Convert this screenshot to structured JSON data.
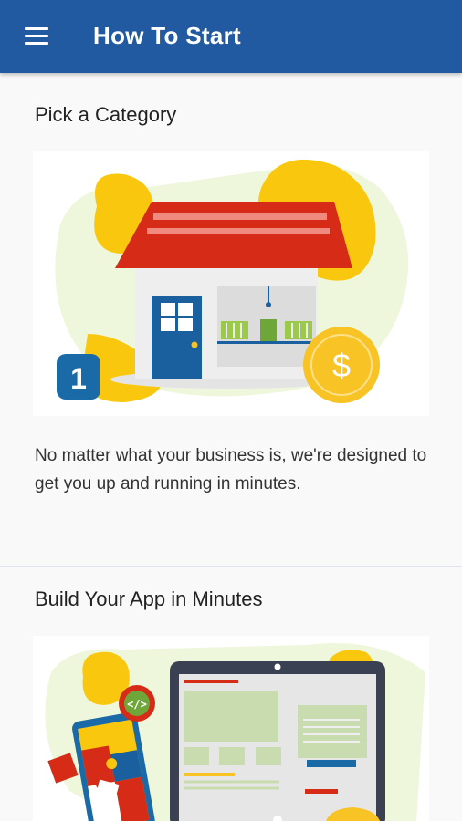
{
  "appbar": {
    "title": "How To Start",
    "menu_icon": "hamburger-menu-icon",
    "background": "#225aa1"
  },
  "sections": [
    {
      "title": "Pick a Category",
      "description": "No matter what your business is, we're designed to get you up and running in minutes.",
      "illustration": {
        "step_badge": "1",
        "icons": [
          "house-icon",
          "dollar-coin-icon",
          "step-badge-icon"
        ],
        "currency_symbol": "$"
      }
    },
    {
      "title": "Build Your App in Minutes",
      "illustration": {
        "code_symbol": "</>",
        "icons": [
          "phone-puzzle-icon",
          "laptop-icon",
          "code-badge-icon"
        ]
      }
    }
  ],
  "colors": {
    "accent": "#225aa1",
    "yellow": "#f9c80e",
    "roof_red": "#d62b16",
    "door_blue": "#1a5f9e",
    "coin": "#f7c325"
  }
}
